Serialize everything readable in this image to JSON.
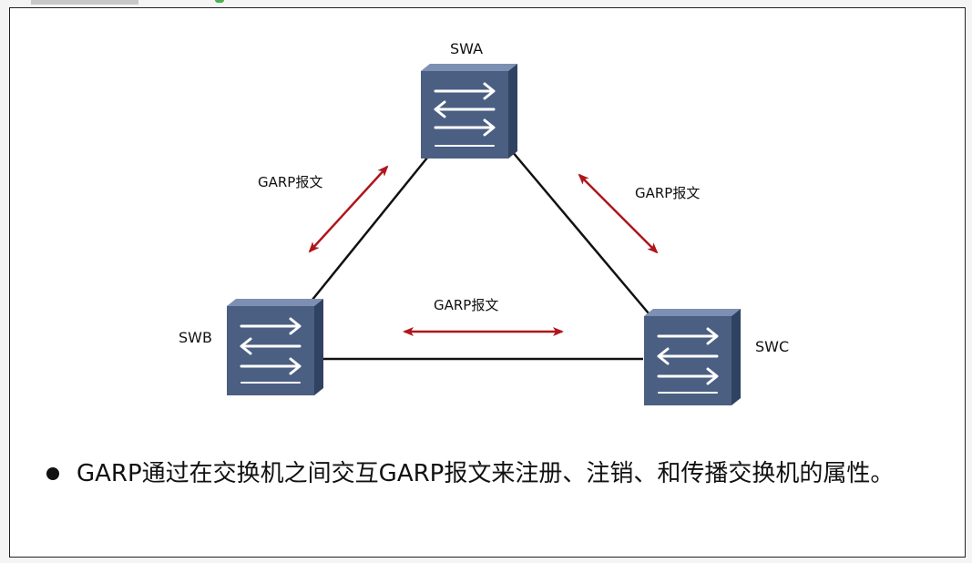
{
  "diagram": {
    "nodes": [
      {
        "id": "swa",
        "label": "SWA"
      },
      {
        "id": "swb",
        "label": "SWB"
      },
      {
        "id": "swc",
        "label": "SWC"
      }
    ],
    "edges": [
      {
        "from": "swa",
        "to": "swb",
        "message": "GARP报文"
      },
      {
        "from": "swa",
        "to": "swc",
        "message": "GARP报文"
      },
      {
        "from": "swb",
        "to": "swc",
        "message": "GARP报文"
      }
    ],
    "colors": {
      "switch_face": "#4a5f82",
      "switch_side": "#2f4261",
      "switch_top": "#7d90b3",
      "link": "#111111",
      "arrow": "#b0151c"
    }
  },
  "bullet": {
    "text": "GARP通过在交换机之间交互GARP报文来注册、注销、和传播交换机的属性。"
  }
}
